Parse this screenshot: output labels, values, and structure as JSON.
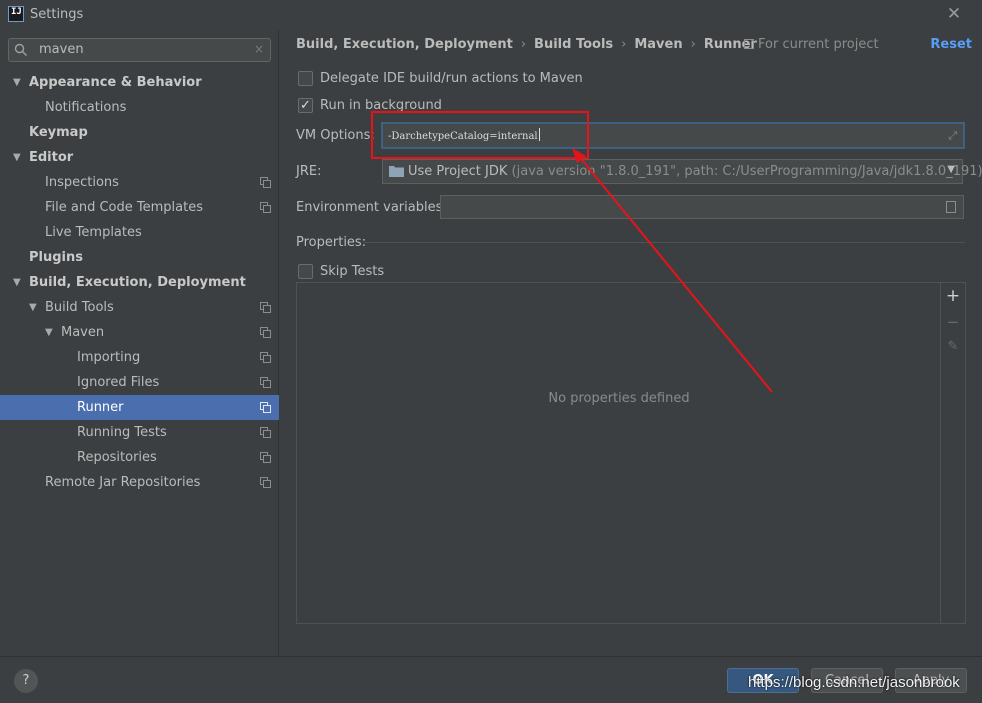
{
  "window": {
    "title": "Settings",
    "app_icon_text": "IJ"
  },
  "search": {
    "value": "maven",
    "clear_glyph": "×"
  },
  "sidebar": {
    "items": [
      {
        "label": "Appearance & Behavior",
        "bold": true,
        "arrow": "▼",
        "level": 0
      },
      {
        "label": "Notifications",
        "bold": false,
        "arrow": "",
        "level": 1
      },
      {
        "label": "Keymap",
        "bold": true,
        "arrow": "",
        "level": 0
      },
      {
        "label": "Editor",
        "bold": true,
        "arrow": "▼",
        "level": 0
      },
      {
        "label": "Inspections",
        "bold": false,
        "arrow": "",
        "level": 1,
        "project_icon": true
      },
      {
        "label": "File and Code Templates",
        "bold": false,
        "arrow": "",
        "level": 1,
        "project_icon": true
      },
      {
        "label": "Live Templates",
        "bold": false,
        "arrow": "",
        "level": 1
      },
      {
        "label": "Plugins",
        "bold": true,
        "arrow": "",
        "level": 0
      },
      {
        "label": "Build, Execution, Deployment",
        "bold": true,
        "arrow": "▼",
        "level": 0
      },
      {
        "label": "Build Tools",
        "bold": false,
        "arrow": "▼",
        "level": 1,
        "project_icon": true
      },
      {
        "label": "Maven",
        "bold": false,
        "arrow": "▼",
        "level": 2,
        "project_icon": true
      },
      {
        "label": "Importing",
        "bold": false,
        "arrow": "",
        "level": 3,
        "project_icon": true
      },
      {
        "label": "Ignored Files",
        "bold": false,
        "arrow": "",
        "level": 3,
        "project_icon": true
      },
      {
        "label": "Runner",
        "bold": false,
        "arrow": "",
        "level": 3,
        "project_icon": true,
        "selected": true
      },
      {
        "label": "Running Tests",
        "bold": false,
        "arrow": "",
        "level": 3,
        "project_icon": true
      },
      {
        "label": "Repositories",
        "bold": false,
        "arrow": "",
        "level": 3,
        "project_icon": true
      },
      {
        "label": "Remote Jar Repositories",
        "bold": false,
        "arrow": "",
        "level": 1,
        "project_icon": true
      }
    ]
  },
  "header": {
    "breadcrumb": [
      "Build, Execution, Deployment",
      "Build Tools",
      "Maven",
      "Runner"
    ],
    "separator": "›",
    "for_project": "For current project",
    "reset_label": "Reset"
  },
  "options": {
    "delegate_label": "Delegate IDE build/run actions to Maven",
    "delegate_checked": false,
    "run_background_label": "Run in background",
    "run_background_checked": true,
    "vm_label": "VM Options:",
    "vm_value": "-DarchetypeCatalog=internal",
    "jre_label": "JRE:",
    "jre_value": "Use Project JDK",
    "jre_desc": "(java version \"1.8.0_191\", path: C:/UserProgramming/Java/jdk1.8.0_191)",
    "env_label": "Environment variables:",
    "env_value": "",
    "properties_label": "Properties:",
    "skip_tests_label": "Skip Tests",
    "skip_tests_checked": false,
    "no_properties_text": "No properties defined",
    "toolbar": {
      "add": "+",
      "remove": "−",
      "edit": "✎"
    }
  },
  "footer": {
    "help": "?",
    "ok_label": "OK",
    "cancel_label": "Cancel",
    "apply_label": "Apply",
    "watermark": "https://blog.csdn.net/jasonbrook"
  },
  "colors": {
    "background": "#3c3f41",
    "selection": "#4b6eaf",
    "link": "#589df6",
    "annotation": "#e8131a"
  }
}
